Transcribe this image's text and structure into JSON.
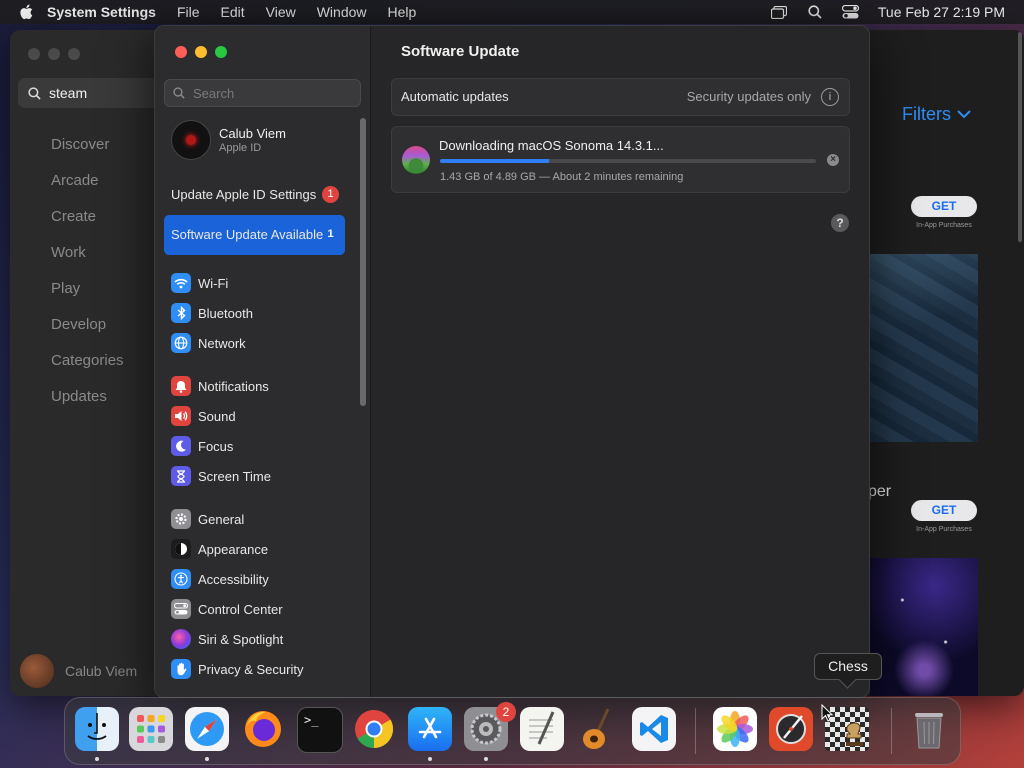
{
  "menubar": {
    "app_name": "System Settings",
    "menus": [
      "File",
      "Edit",
      "View",
      "Window",
      "Help"
    ],
    "clock": "Tue Feb 27  2:19 PM"
  },
  "app_store": {
    "search_value": "steam",
    "nav": [
      "Discover",
      "Arcade",
      "Create",
      "Work",
      "Play",
      "Develop",
      "Categories",
      "Updates"
    ],
    "user_name": "Calub Viem",
    "filters_label": "Filters",
    "get_label": "GET",
    "in_app_purchases": "In-App Purchases",
    "partial_title": "per"
  },
  "settings": {
    "search_placeholder": "Search",
    "account": {
      "name": "Calub Viem",
      "sub": "Apple ID"
    },
    "update_apple_id": {
      "label": "Update Apple ID Settings",
      "badge": "1"
    },
    "software_update_row": {
      "label": "Software Update Available",
      "badge": "1"
    },
    "sidebar_groups": [
      [
        {
          "label": "Wi-Fi",
          "icon": "wifi-icon",
          "color": "#2f8ef5"
        },
        {
          "label": "Bluetooth",
          "icon": "bluetooth-icon",
          "color": "#2f8ef5"
        },
        {
          "label": "Network",
          "icon": "network-icon",
          "color": "#2f8ef5"
        }
      ],
      [
        {
          "label": "Notifications",
          "icon": "notifications-icon",
          "color": "#e0443e"
        },
        {
          "label": "Sound",
          "icon": "sound-icon",
          "color": "#e0443e"
        },
        {
          "label": "Focus",
          "icon": "focus-icon",
          "color": "#5e5ce6"
        },
        {
          "label": "Screen Time",
          "icon": "screen-time-icon",
          "color": "#5e5ce6"
        }
      ],
      [
        {
          "label": "General",
          "icon": "general-icon",
          "color": "#8e8e93"
        },
        {
          "label": "Appearance",
          "icon": "appearance-icon",
          "color": "#1c1c1e"
        },
        {
          "label": "Accessibility",
          "icon": "accessibility-icon",
          "color": "#2f8ef5"
        },
        {
          "label": "Control Center",
          "icon": "control-center-icon",
          "color": "#8e8e93"
        },
        {
          "label": "Siri & Spotlight",
          "icon": "siri-icon",
          "color": "#b44bd8"
        },
        {
          "label": "Privacy & Security",
          "icon": "privacy-hand-icon",
          "color": "#2f8ef5"
        }
      ]
    ],
    "content": {
      "title": "Software Update",
      "auto_updates_label": "Automatic updates",
      "auto_updates_value": "Security updates only",
      "info_glyph": "i",
      "download_title": "Downloading macOS Sonoma 14.3.1...",
      "download_progress": 0.29,
      "download_status": "1.43 GB of 4.89 GB — About 2 minutes remaining",
      "cancel_glyph": "×",
      "help_glyph": "?"
    }
  },
  "tooltip": {
    "text": "Chess"
  },
  "dock": {
    "apps": [
      {
        "name": "Finder",
        "icon": "finder-icon",
        "running": true
      },
      {
        "name": "Launchpad",
        "icon": "launchpad-icon",
        "running": false
      },
      {
        "name": "Safari",
        "icon": "safari-icon",
        "running": true
      },
      {
        "name": "Firefox",
        "icon": "firefox-icon",
        "running": false
      },
      {
        "name": "Terminal",
        "icon": "terminal-icon",
        "running": false
      },
      {
        "name": "Chrome",
        "icon": "chrome-icon",
        "running": false
      },
      {
        "name": "App Store",
        "icon": "app-store-icon",
        "running": true
      },
      {
        "name": "System Settings",
        "icon": "system-settings-icon",
        "running": true,
        "badge": "2"
      },
      {
        "name": "TextEdit",
        "icon": "textedit-icon",
        "running": false
      },
      {
        "name": "GarageBand",
        "icon": "garageband-icon",
        "running": false
      },
      {
        "name": "VS Code",
        "icon": "vscode-icon",
        "running": false
      },
      {
        "name": "Photos",
        "icon": "photos-icon",
        "running": false
      },
      {
        "name": "Instruments",
        "icon": "instruments-icon",
        "running": false
      },
      {
        "name": "Chess",
        "icon": "chess-icon",
        "running": false
      },
      {
        "name": "Trash",
        "icon": "trash-icon",
        "running": false
      }
    ],
    "terminal_prompt": ">_"
  }
}
